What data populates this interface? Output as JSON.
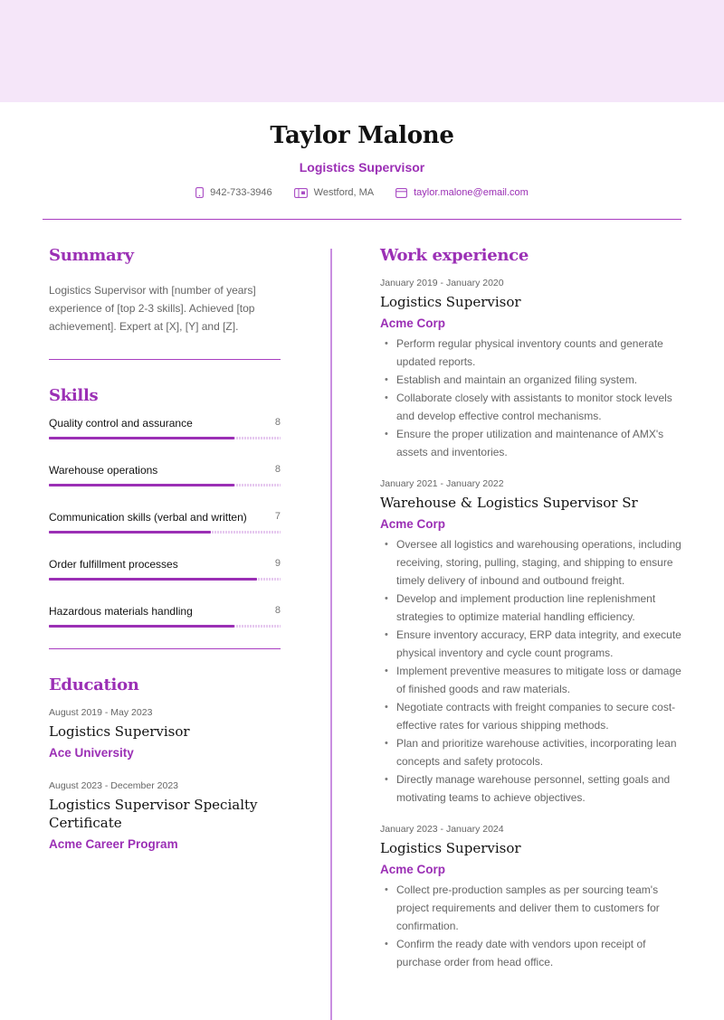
{
  "header": {
    "name": "Taylor Malone",
    "title": "Logistics Supervisor",
    "contacts": [
      {
        "icon": "phone-icon",
        "text": "942-733-3946"
      },
      {
        "icon": "map-icon",
        "text": "Westford, MA"
      },
      {
        "icon": "email-icon",
        "text": "taylor.malone@email.com"
      }
    ]
  },
  "colors": {
    "accent": "#9b2fb5",
    "banner": "#f5e6f9",
    "muted_text": "#666666"
  },
  "summary": {
    "heading": "Summary",
    "text": "Logistics Supervisor with [number of years] experience of [top 2-3 skills]. Achieved [top achievement]. Expert at [X], [Y] and [Z]."
  },
  "skills": {
    "heading": "Skills",
    "scale_max": 10,
    "items": [
      {
        "name": "Quality control and assurance",
        "value": 8
      },
      {
        "name": "Warehouse operations",
        "value": 8
      },
      {
        "name": "Communication skills (verbal and written)",
        "value": 7
      },
      {
        "name": "Order fulfillment processes",
        "value": 9
      },
      {
        "name": "Hazardous materials handling",
        "value": 8
      }
    ]
  },
  "education": {
    "heading": "Education",
    "items": [
      {
        "date": "August 2019 - May 2023",
        "degree": "Logistics Supervisor",
        "school": "Ace University"
      },
      {
        "date": "August 2023 - December 2023",
        "degree": "Logistics Supervisor Specialty Certificate",
        "school": "Acme Career Program"
      }
    ]
  },
  "work": {
    "heading": "Work experience",
    "items": [
      {
        "date": "January 2019 - January 2020",
        "role": "Logistics Supervisor",
        "company": "Acme Corp",
        "bullets": [
          "Perform regular physical inventory counts and generate updated reports.",
          "Establish and maintain an organized filing system.",
          "Collaborate closely with assistants to monitor stock levels and develop effective control mechanisms.",
          "Ensure the proper utilization and maintenance of AMX's assets and inventories."
        ]
      },
      {
        "date": "January 2021 - January 2022",
        "role": "Warehouse & Logistics Supervisor Sr",
        "company": "Acme Corp",
        "bullets": [
          "Oversee all logistics and warehousing operations, including receiving, storing, pulling, staging, and shipping to ensure timely delivery of inbound and outbound freight.",
          "Develop and implement production line replenishment strategies to optimize material handling efficiency.",
          "Ensure inventory accuracy, ERP data integrity, and execute physical inventory and cycle count programs.",
          "Implement preventive measures to mitigate loss or damage of finished goods and raw materials.",
          "Negotiate contracts with freight companies to secure cost-effective rates for various shipping methods.",
          "Plan and prioritize warehouse activities, incorporating lean concepts and safety protocols.",
          "Directly manage warehouse personnel, setting goals and motivating teams to achieve objectives."
        ]
      },
      {
        "date": "January 2023 - January 2024",
        "role": "Logistics Supervisor",
        "company": "Acme Corp",
        "bullets": [
          "Collect pre-production samples as per sourcing team's project requirements and deliver them to customers for confirmation.",
          "Confirm the ready date with vendors upon receipt of purchase order from head office."
        ]
      }
    ]
  }
}
